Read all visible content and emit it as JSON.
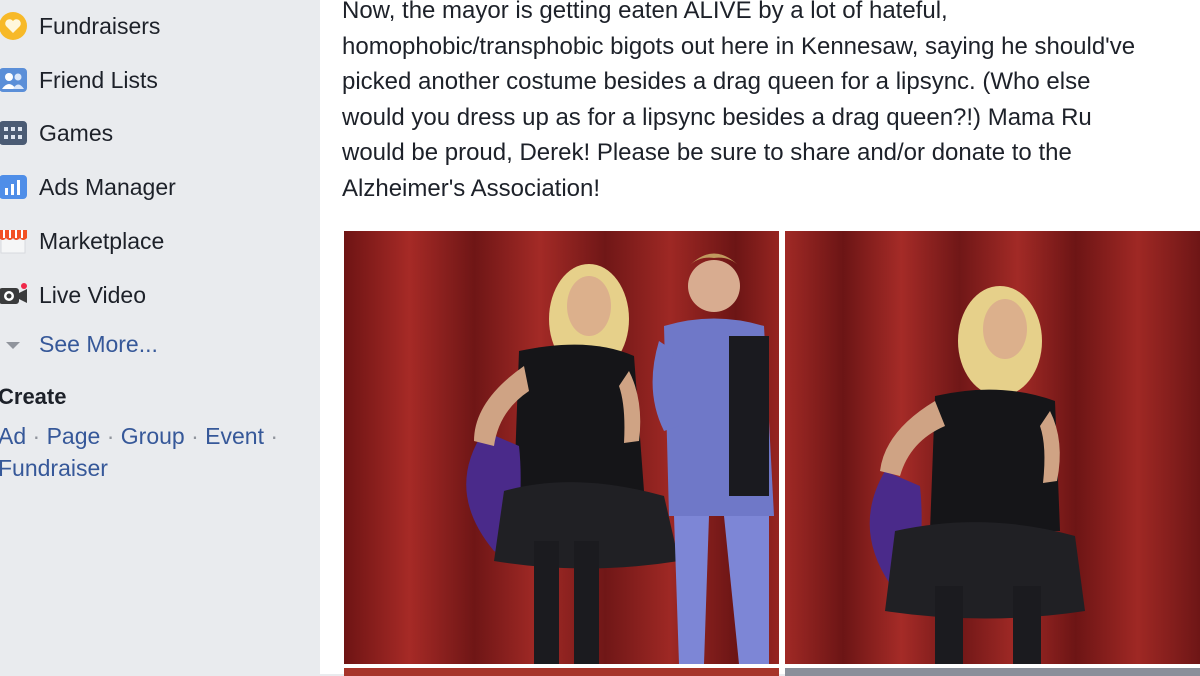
{
  "sidebar": {
    "items": [
      {
        "label": "Fundraisers",
        "icon": "heart-coin-icon"
      },
      {
        "label": "Friend Lists",
        "icon": "friends-icon"
      },
      {
        "label": "Games",
        "icon": "games-icon"
      },
      {
        "label": "Ads Manager",
        "icon": "bar-chart-icon"
      },
      {
        "label": "Marketplace",
        "icon": "storefront-icon"
      },
      {
        "label": "Live Video",
        "icon": "video-camera-icon"
      },
      {
        "label": "See More...",
        "icon": "chevron-down-icon"
      }
    ],
    "create": {
      "heading": "Create",
      "links": [
        "Ad",
        "Page",
        "Group",
        "Event",
        "Fundraiser"
      ],
      "separator": "·"
    }
  },
  "post": {
    "lines": [
      "Now, the mayor is getting eaten ALIVE by a lot of hateful,",
      "homophobic/transphobic bigots out here in Kennesaw, saying he should've",
      "picked another costume besides a drag queen for a lipsync. (Who else",
      "would you dress up as for a lipsync besides a drag queen?!) Mama Ru",
      "would be proud, Derek! Please be sure to share and/or donate to the",
      "Alzheimer's Association!"
    ],
    "photos": [
      "stage-photo-performer-with-host",
      "stage-photo-performer-solo"
    ]
  },
  "colors": {
    "link": "#365899",
    "text": "#1d2129",
    "sidebar_bg": "#e9ebee",
    "curtain": "#8e1f1f"
  }
}
